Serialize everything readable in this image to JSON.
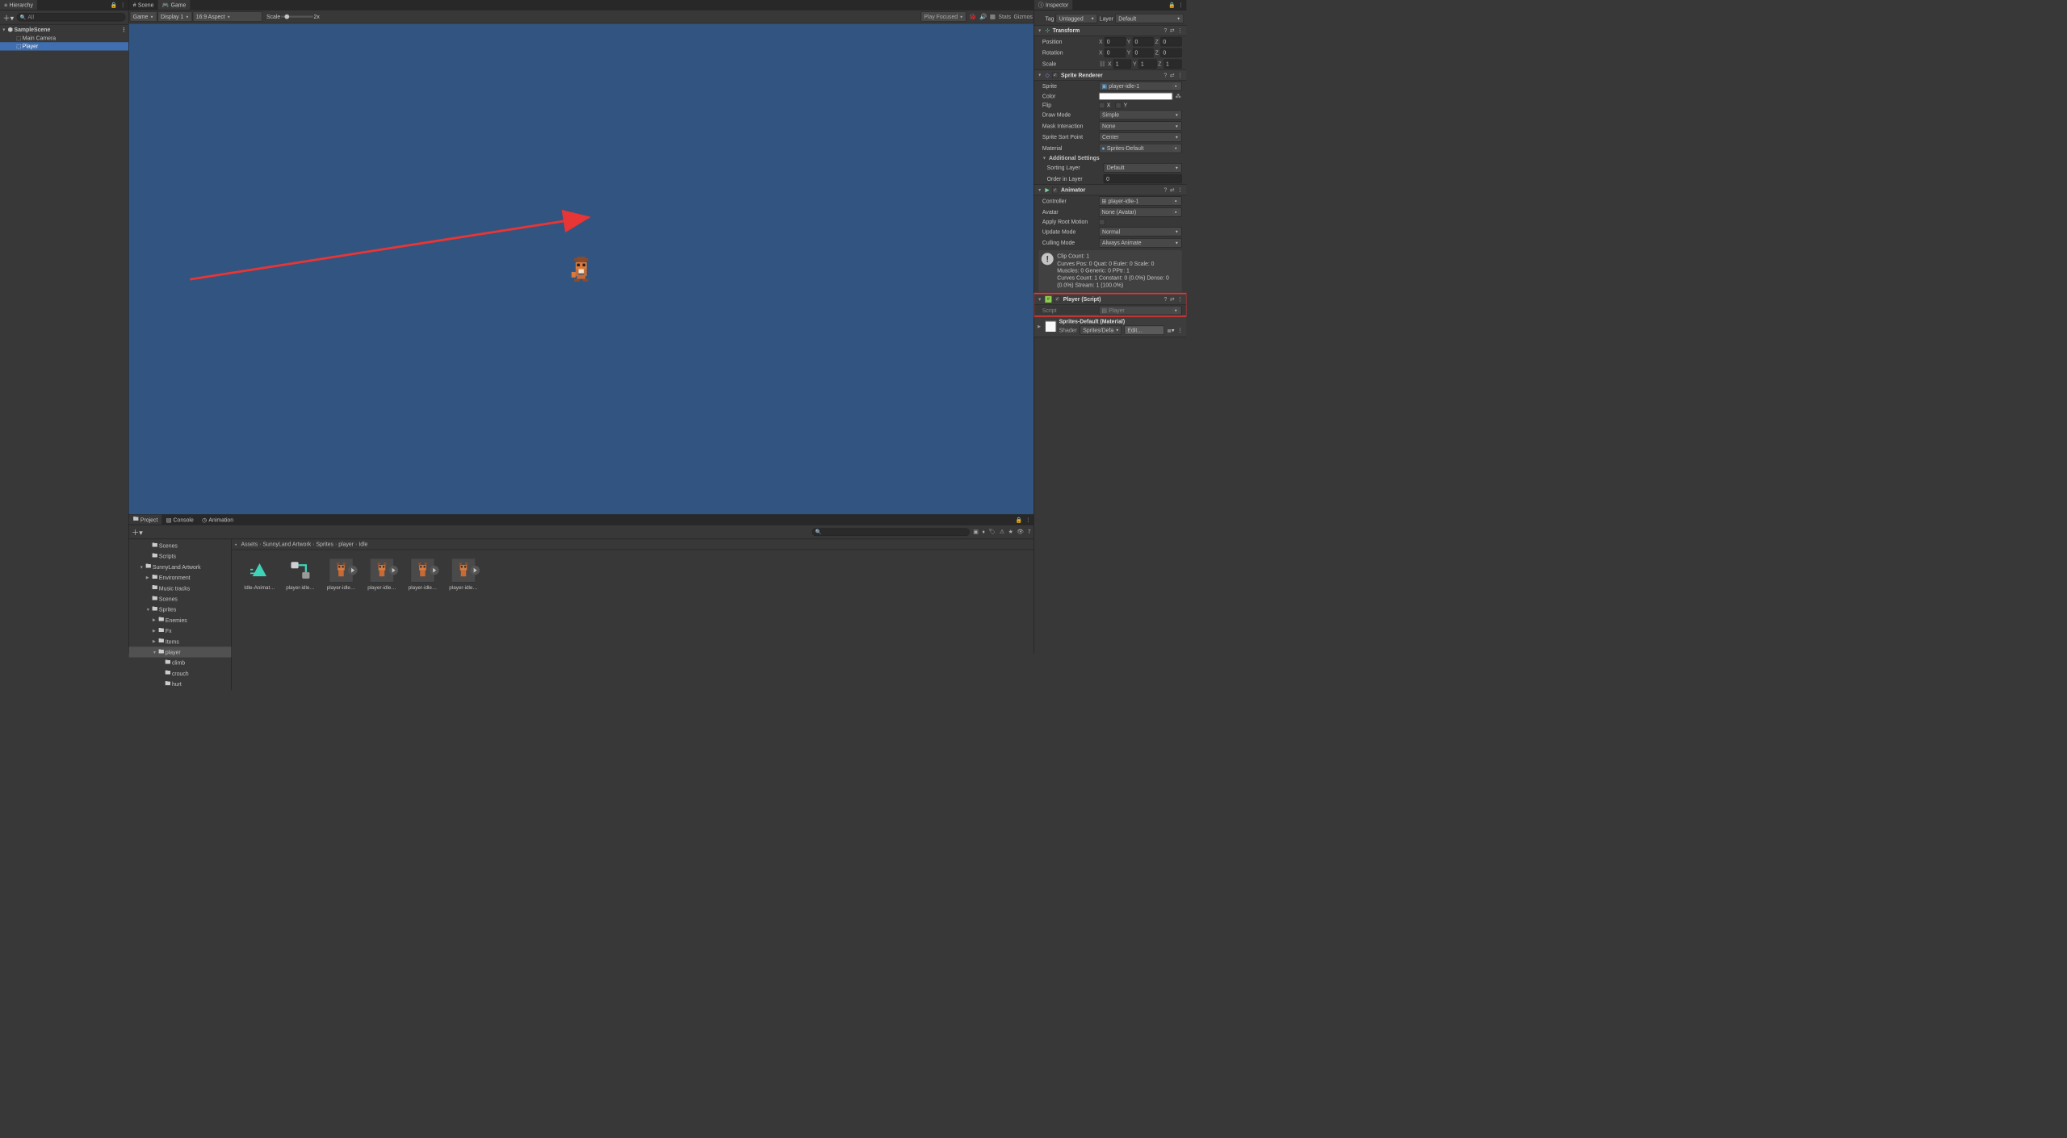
{
  "hierarchy": {
    "title": "Hierarchy",
    "search": "All",
    "scene": "SampleScene",
    "items": [
      "Main Camera",
      "Player"
    ],
    "selected": 1
  },
  "scene_tab": "Scene",
  "game_tab": "Game",
  "game_toolbar": {
    "camera": "Game",
    "display": "Display 1",
    "aspect": "16:9 Aspect",
    "scale_label": "Scale",
    "scale_value": "2x",
    "play_mode": "Play Focused",
    "stats": "Stats",
    "gizmos": "Gizmos"
  },
  "bottom_tabs": {
    "project": "Project",
    "console": "Console",
    "animation": "Animation"
  },
  "bottom_toolbar": {
    "hidden": "7"
  },
  "breadcrumb": [
    "Assets",
    "SunnyLand Artwork",
    "Sprites",
    "player",
    "Idle"
  ],
  "project_tree": {
    "items": [
      {
        "depth": 1,
        "arrow": "",
        "icon": "folder",
        "label": "Scenes"
      },
      {
        "depth": 1,
        "arrow": "",
        "icon": "folder",
        "label": "Scripts"
      },
      {
        "depth": 0,
        "arrow": "▼",
        "icon": "folder",
        "label": "SunnyLand Artwork"
      },
      {
        "depth": 1,
        "arrow": "▶",
        "icon": "folder",
        "label": "Environment"
      },
      {
        "depth": 1,
        "arrow": "",
        "icon": "folder",
        "label": "Music tracks"
      },
      {
        "depth": 1,
        "arrow": "",
        "icon": "folder",
        "label": "Scenes"
      },
      {
        "depth": 1,
        "arrow": "▼",
        "icon": "folder",
        "label": "Sprites"
      },
      {
        "depth": 2,
        "arrow": "▶",
        "icon": "folder",
        "label": "Enemies"
      },
      {
        "depth": 2,
        "arrow": "▶",
        "icon": "folder",
        "label": "Fx"
      },
      {
        "depth": 2,
        "arrow": "▶",
        "icon": "folder",
        "label": "Items"
      },
      {
        "depth": 2,
        "arrow": "▼",
        "icon": "folder",
        "label": "player",
        "sel": true
      },
      {
        "depth": 3,
        "arrow": "",
        "icon": "folder",
        "label": "climb"
      },
      {
        "depth": 3,
        "arrow": "",
        "icon": "folder",
        "label": "crouch"
      },
      {
        "depth": 3,
        "arrow": "",
        "icon": "folder",
        "label": "hurt"
      }
    ]
  },
  "assets": [
    {
      "type": "anim",
      "label": "Idle-Animat…"
    },
    {
      "type": "ctrl",
      "label": "player-idle…"
    },
    {
      "type": "sprite",
      "label": "player-idle…"
    },
    {
      "type": "sprite",
      "label": "player-idle…"
    },
    {
      "type": "sprite",
      "label": "player-idle…"
    },
    {
      "type": "sprite",
      "label": "player-idle…"
    }
  ],
  "inspector": {
    "title": "Inspector",
    "tag_label": "Tag",
    "tag_value": "Untagged",
    "layer_label": "Layer",
    "layer_value": "Default",
    "transform": {
      "title": "Transform",
      "position": {
        "label": "Position",
        "x": "0",
        "y": "0",
        "z": "0"
      },
      "rotation": {
        "label": "Rotation",
        "x": "0",
        "y": "0",
        "z": "0"
      },
      "scale": {
        "label": "Scale",
        "x": "1",
        "y": "1",
        "z": "1"
      }
    },
    "sprite_renderer": {
      "title": "Sprite Renderer",
      "sprite_label": "Sprite",
      "sprite_value": "player-idle-1",
      "color_label": "Color",
      "flip_label": "Flip",
      "flip_x": "X",
      "flip_y": "Y",
      "draw_label": "Draw Mode",
      "draw_value": "Simple",
      "mask_label": "Mask Interaction",
      "mask_value": "None",
      "sort_label": "Sprite Sort Point",
      "sort_value": "Center",
      "mat_label": "Material",
      "mat_value": "Sprites-Default",
      "add_title": "Additional Settings",
      "sortlayer_label": "Sorting Layer",
      "sortlayer_value": "Default",
      "order_label": "Order in Layer",
      "order_value": "0"
    },
    "animator": {
      "title": "Animator",
      "controller_label": "Controller",
      "controller_value": "player-idle-1",
      "avatar_label": "Avatar",
      "avatar_value": "None (Avatar)",
      "root_label": "Apply Root Motion",
      "update_label": "Update Mode",
      "update_value": "Normal",
      "cull_label": "Culling Mode",
      "cull_value": "Always Animate",
      "info": "Clip Count: 1\nCurves Pos: 0 Quat: 0 Euler: 0 Scale: 0\nMuscles: 0 Generic: 0 PPtr: 1\nCurves Count: 1 Constant: 0 (0.0%) Dense: 0 (0.0%) Stream: 1 (100.0%)"
    },
    "player_script": {
      "title": "Player (Script)",
      "script_label": "Script",
      "script_value": "Player"
    },
    "material": {
      "title": "Sprites-Default (Material)",
      "shader_label": "Shader",
      "shader_value": "Sprites/Defa",
      "edit": "Edit…"
    }
  }
}
